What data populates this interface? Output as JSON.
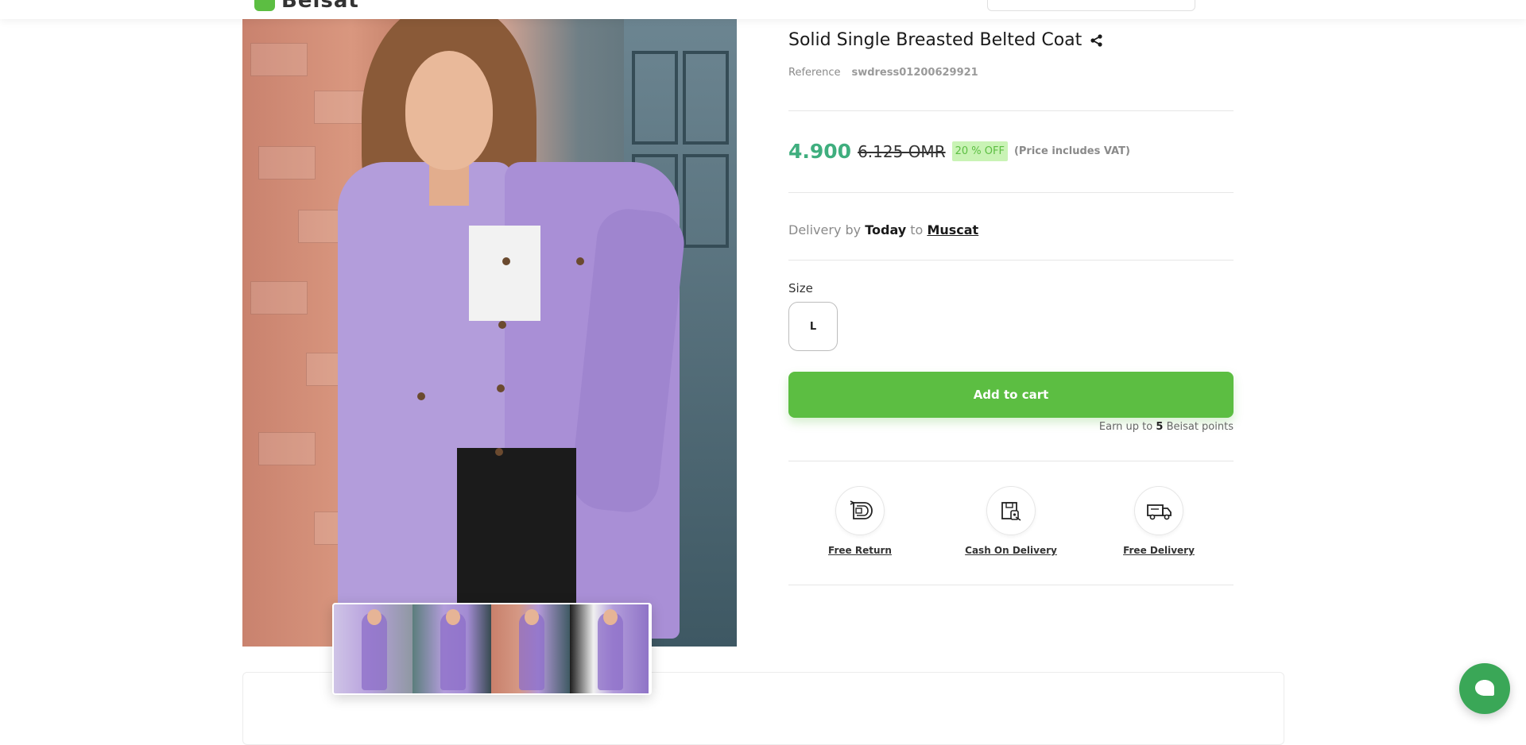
{
  "header": {
    "logo_text": "Beisat"
  },
  "product": {
    "title": "Solid Single Breasted Belted Coat",
    "reference_label": "Reference",
    "reference_value": "swdress01200629921",
    "price": "4.900",
    "old_price": "6.125 OMR",
    "discount": "20 % OFF",
    "vat_note": "(Price includes VAT)",
    "delivery": {
      "prefix": "Delivery by",
      "when": "Today",
      "to": "to",
      "city": "Muscat"
    },
    "size": {
      "label": "Size",
      "options": [
        "L"
      ]
    },
    "add_to_cart_label": "Add to cart",
    "points": {
      "prefix": "Earn up to",
      "value": "5",
      "suffix": "Beisat points"
    },
    "features": [
      {
        "label": "Free Return",
        "icon": "return-box-icon"
      },
      {
        "label": "Cash On Delivery",
        "icon": "cash-on-delivery-icon"
      },
      {
        "label": "Free Delivery",
        "icon": "delivery-truck-icon"
      }
    ],
    "gallery": {
      "thumbnail_count": 4
    }
  },
  "colors": {
    "accent_green": "#5cbe42",
    "price_green": "#3fae7e",
    "discount_bg": "#c9f3b5",
    "coat_purple": "#b39ddb",
    "chat_green": "#3aa757"
  },
  "icons": {
    "share": "share-icon",
    "chat": "chat-bubble-icon"
  }
}
